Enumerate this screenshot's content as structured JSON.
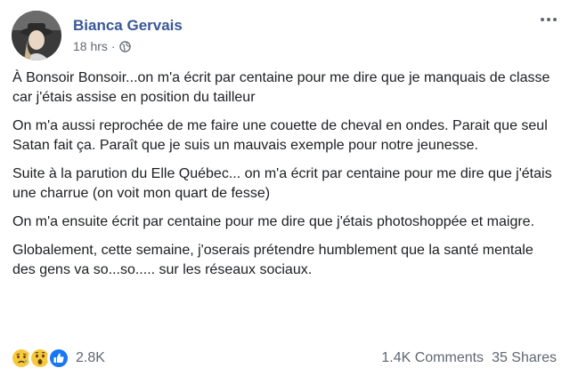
{
  "post": {
    "author": "Bianca Gervais",
    "timestamp": "18 hrs",
    "separator": "·",
    "privacy_icon": "globe-icon",
    "paragraphs": [
      "À Bonsoir Bonsoir...on m'a écrit par centaine pour me dire que je manquais de classe car j'étais assise en position du tailleur",
      "On m'a aussi reprochée de me faire une couette de cheval en ondes. Parait que seul Satan fait ça. Paraît que je suis un mauvais exemple pour notre jeunesse.",
      "Suite à la parution du Elle Québec... on m'a écrit par centaine pour me dire que j'étais une charrue (on voit mon quart de fesse)",
      "On m'a ensuite écrit par centaine pour me dire que j'étais photoshoppée et maigre.",
      "Globalement, cette semaine, j'oserais prétendre humblement que la santé mentale des gens va so...so..... sur les réseaux sociaux."
    ]
  },
  "footer": {
    "reaction_icons": [
      "sad-face-icon",
      "wow-face-icon",
      "like-thumb-icon"
    ],
    "reaction_count": "2.8K",
    "comments": "1.4K Comments",
    "shares": "35 Shares"
  },
  "colors": {
    "author_link": "#385898",
    "secondary_text": "#606770",
    "like_blue": "#1877f2",
    "emoji_yellow": "#f7c93e"
  }
}
